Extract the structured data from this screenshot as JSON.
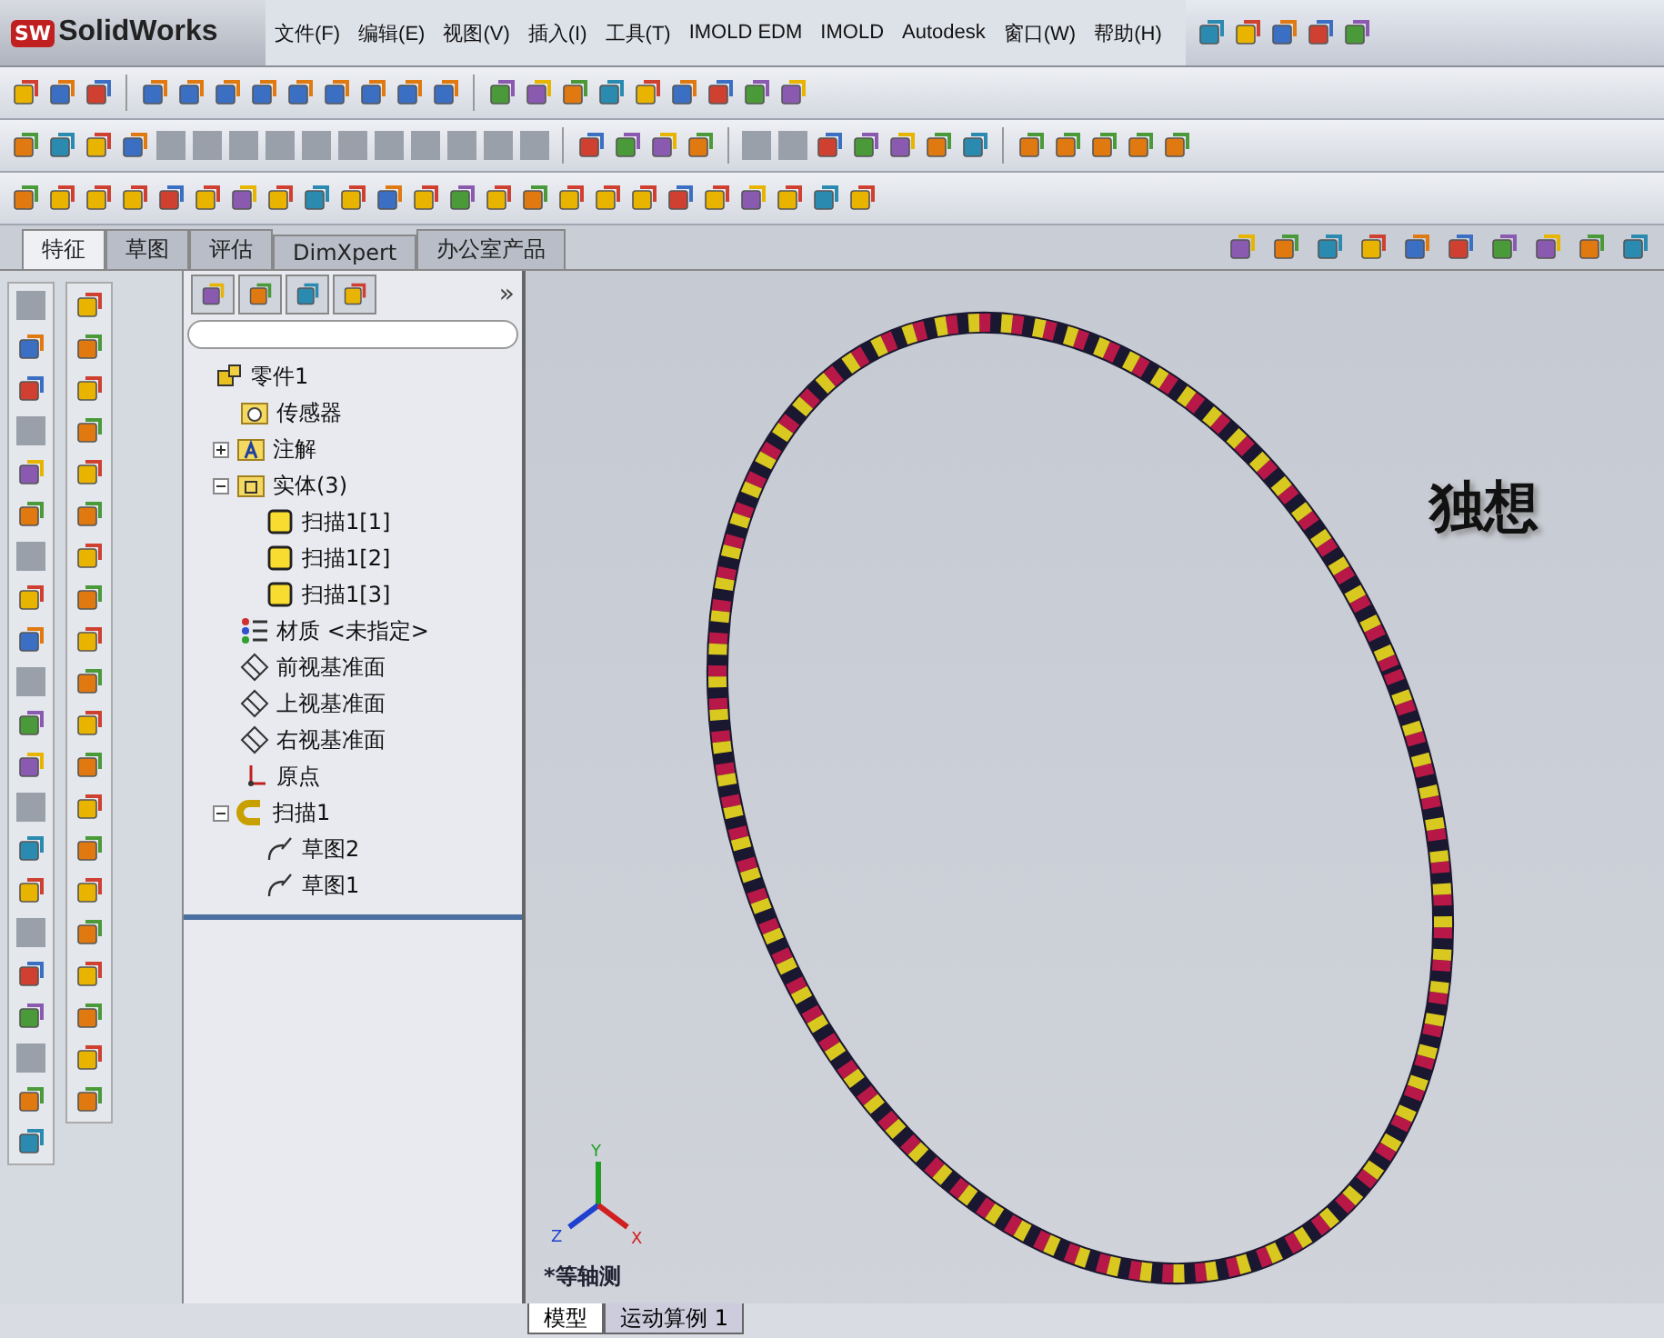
{
  "app": {
    "logo_badge": "SW",
    "logo_text": "SolidWorks"
  },
  "menu": [
    "文件(F)",
    "编辑(E)",
    "视图(V)",
    "插入(I)",
    "工具(T)",
    "IMOLD EDM",
    "IMOLD",
    "Autodesk",
    "窗口(W)",
    "帮助(H)"
  ],
  "tabs": [
    {
      "label": "特征",
      "selected": true
    },
    {
      "label": "草图",
      "selected": false
    },
    {
      "label": "评估",
      "selected": false
    },
    {
      "label": "DimXpert",
      "selected": false
    },
    {
      "label": "办公室产品",
      "selected": false
    }
  ],
  "feature_tree": {
    "panel_more": "»",
    "items": [
      {
        "label": "零件1",
        "kind": "part",
        "children": [
          {
            "label": "传感器",
            "kind": "sensor-folder"
          },
          {
            "label": "注解",
            "kind": "annotation-folder",
            "expanded": false
          },
          {
            "label": "实体(3)",
            "kind": "solid-folder",
            "expanded": true,
            "children": [
              {
                "label": "扫描1[1]",
                "kind": "solid"
              },
              {
                "label": "扫描1[2]",
                "kind": "solid"
              },
              {
                "label": "扫描1[3]",
                "kind": "solid"
              }
            ]
          },
          {
            "label": "材质 <未指定>",
            "kind": "material"
          },
          {
            "label": "前视基准面",
            "kind": "plane"
          },
          {
            "label": "上视基准面",
            "kind": "plane"
          },
          {
            "label": "右视基准面",
            "kind": "plane"
          },
          {
            "label": "原点",
            "kind": "origin"
          },
          {
            "label": "扫描1",
            "kind": "sweep",
            "expanded": true,
            "children": [
              {
                "label": "草图2",
                "kind": "sketch"
              },
              {
                "label": "草图1",
                "kind": "sketch"
              }
            ]
          }
        ]
      }
    ]
  },
  "viewport": {
    "overlay_text": "独想",
    "view_name": "*等轴测",
    "triad": {
      "y": "Y",
      "z": "Z",
      "x": "X"
    }
  },
  "bottom_tabs": [
    {
      "label": "模型",
      "selected": true
    },
    {
      "label": "运动算例 1",
      "selected": false
    }
  ]
}
